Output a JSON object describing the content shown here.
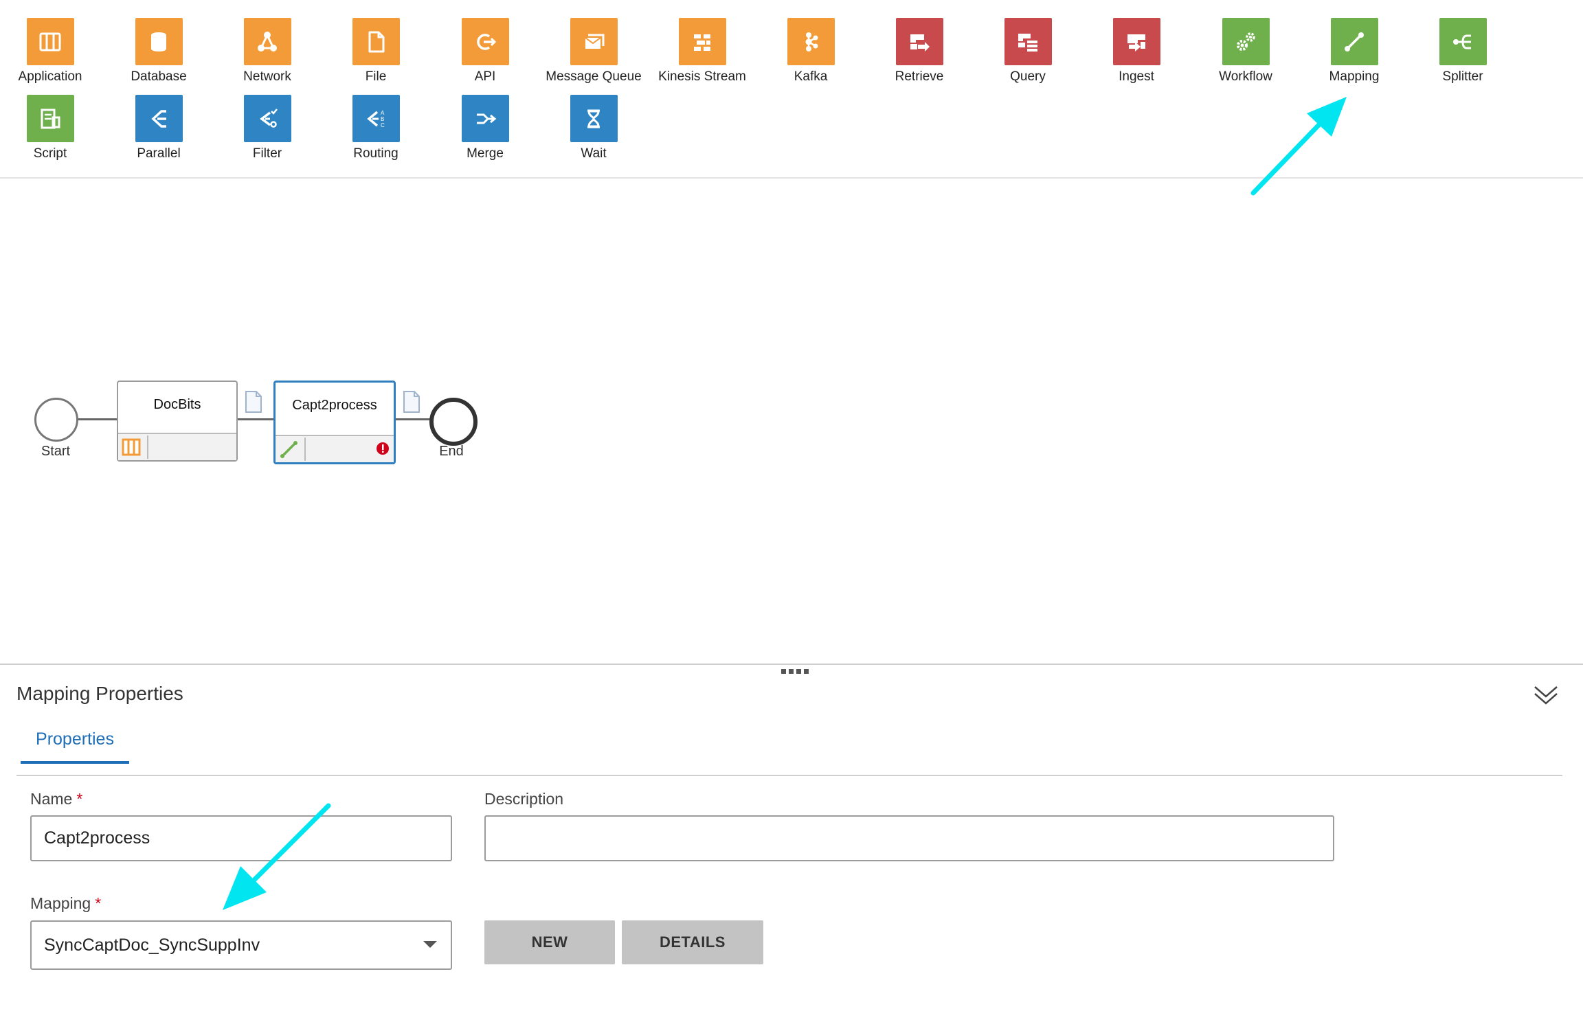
{
  "palette": {
    "row1": [
      {
        "label": "Application",
        "color": "#f29b38",
        "icon": "application-icon"
      },
      {
        "label": "Database",
        "color": "#f29b38",
        "icon": "database-icon"
      },
      {
        "label": "Network",
        "color": "#f29b38",
        "icon": "network-icon"
      },
      {
        "label": "File",
        "color": "#f29b38",
        "icon": "file-icon"
      },
      {
        "label": "API",
        "color": "#f29b38",
        "icon": "api-icon"
      },
      {
        "label": "Message Queue",
        "color": "#f29b38",
        "icon": "message-queue-icon"
      },
      {
        "label": "Kinesis Stream",
        "color": "#f29b38",
        "icon": "kinesis-stream-icon"
      },
      {
        "label": "Kafka",
        "color": "#f29b38",
        "icon": "kafka-icon"
      },
      {
        "label": "Retrieve",
        "color": "#c84a4d",
        "icon": "retrieve-icon"
      },
      {
        "label": "Query",
        "color": "#c84a4d",
        "icon": "query-icon"
      },
      {
        "label": "Ingest",
        "color": "#c84a4d",
        "icon": "ingest-icon"
      },
      {
        "label": "Workflow",
        "color": "#6fb04d",
        "icon": "workflow-icon"
      },
      {
        "label": "Mapping",
        "color": "#6fb04d",
        "icon": "mapping-icon"
      },
      {
        "label": "Splitter",
        "color": "#6fb04d",
        "icon": "splitter-icon"
      }
    ],
    "row2": [
      {
        "label": "Script",
        "color": "#6fb04d",
        "icon": "script-icon"
      },
      {
        "label": "Parallel",
        "color": "#2f85c4",
        "icon": "parallel-icon"
      },
      {
        "label": "Filter",
        "color": "#2f85c4",
        "icon": "filter-icon"
      },
      {
        "label": "Routing",
        "color": "#2f85c4",
        "icon": "routing-icon"
      },
      {
        "label": "Merge",
        "color": "#2f85c4",
        "icon": "merge-icon"
      },
      {
        "label": "Wait",
        "color": "#2f85c4",
        "icon": "wait-icon"
      }
    ]
  },
  "flow": {
    "start_label": "Start",
    "end_label": "End",
    "task1": {
      "name": "DocBits",
      "icon": "application-icon"
    },
    "task2": {
      "name": "Capt2process",
      "icon": "mapping-icon",
      "status": "error-icon"
    }
  },
  "panel": {
    "title": "Mapping Properties",
    "tab_label": "Properties",
    "name_label": "Name",
    "name_value": "Capt2process",
    "description_label": "Description",
    "description_value": "",
    "mapping_label": "Mapping",
    "mapping_value": "SyncCaptDoc_SyncSuppInv",
    "required_mark": "*",
    "new_button": "NEW",
    "details_button": "DETAILS"
  },
  "colors": {
    "orange": "#f29b38",
    "red": "#c84a4d",
    "green": "#6fb04d",
    "blue": "#2f85c4",
    "accent": "#1f6fb8",
    "annotation": "#00e5ef"
  }
}
